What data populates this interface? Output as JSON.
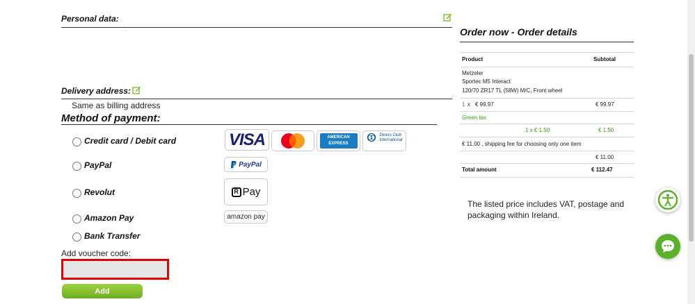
{
  "personal": {
    "title": "Personal data:"
  },
  "delivery": {
    "title": "Delivery address:",
    "same_as_billing": "Same as billing address"
  },
  "payment": {
    "title": "Method of payment:",
    "options": [
      {
        "label": "Credit card / Debit card",
        "logos": [
          "VISA",
          "mastercard",
          "AMERICAN EXPRESS",
          "Diners Club International"
        ]
      },
      {
        "label": "PayPal",
        "logo": "PayPal"
      },
      {
        "label": "Revolut",
        "logo": "Pay"
      },
      {
        "label": "Amazon Pay",
        "logo": "amazon pay"
      },
      {
        "label": "Bank Transfer"
      }
    ]
  },
  "voucher": {
    "label": "Add voucher code:",
    "value": "",
    "button": "Add"
  },
  "order": {
    "title": "Order now - Order details",
    "columns": {
      "product": "Product",
      "subtotal": "Subtotal"
    },
    "product": {
      "brand": "Metzeler",
      "model": "Sportec M5 Interact",
      "spec": "120/70 ZR17 TL (58W) M/C, Front wheel"
    },
    "qty": "1",
    "qty_sep": "x",
    "unit_price": "€ 99.97",
    "line_subtotal": "€ 99.97",
    "green_tax_label": "Green tax",
    "green_tax_qty_price": "1 x € 1.50",
    "green_tax_subtotal": "€ 1.50",
    "shipping_note": "€ 11.00 , shipping fee for choosing only one item",
    "shipping_subtotal": "€ 11.00",
    "total_label": "Total amount",
    "total_value": "€ 112.47",
    "vat_note": "The listed price includes VAT, postage and packaging within Ireland."
  },
  "colors": {
    "accent_green": "#7ab928",
    "voucher_border": "#e00000",
    "button_green": "#8cc63f",
    "fab_green": "#5bb02a"
  },
  "icons": {
    "edit": "edit-icon",
    "accessibility": "accessibility-icon",
    "chat": "chat-icon"
  }
}
